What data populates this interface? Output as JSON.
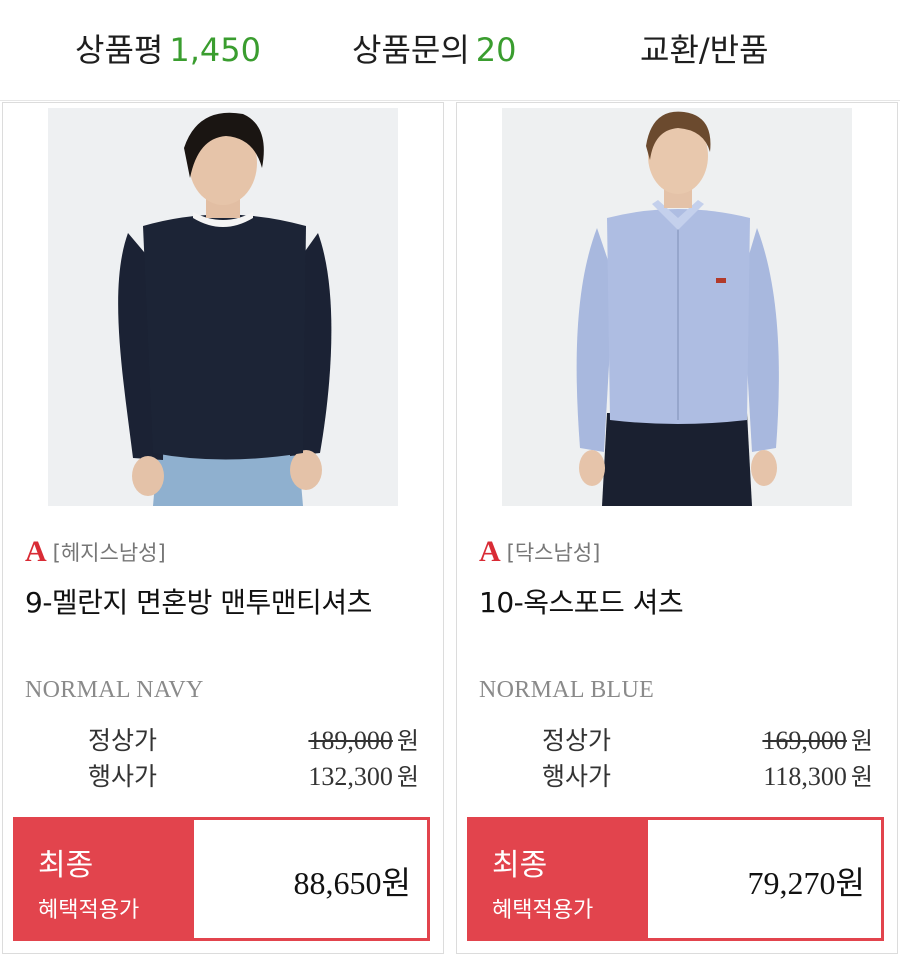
{
  "tabs": [
    {
      "label": "상품평",
      "count": "1,450"
    },
    {
      "label": "상품문의",
      "count": "20"
    },
    {
      "label": "교환/반품",
      "count": ""
    }
  ],
  "products": [
    {
      "brand_logo": "A",
      "brand": "[헤지스남성]",
      "title": "9-멜란지 면혼방 맨투맨티셔츠",
      "option": "NORMAL NAVY",
      "regular_label": "정상가",
      "regular_price": "189,000",
      "sale_label": "행사가",
      "sale_price": "132,300",
      "currency": "원",
      "final_label_1": "최종",
      "final_label_2": "혜택적용가",
      "final_price": "88,650원"
    },
    {
      "brand_logo": "A",
      "brand": "[닥스남성]",
      "title": "10-옥스포드 셔츠",
      "option": "NORMAL BLUE",
      "regular_label": "정상가",
      "regular_price": "169,000",
      "sale_label": "행사가",
      "sale_price": "118,300",
      "currency": "원",
      "final_label_1": "최종",
      "final_label_2": "혜택적용가",
      "final_price": "79,270원"
    }
  ],
  "colors": {
    "accent_red": "#e2444d",
    "count_green": "#3a9d2f",
    "brand_red": "#d92b35"
  }
}
